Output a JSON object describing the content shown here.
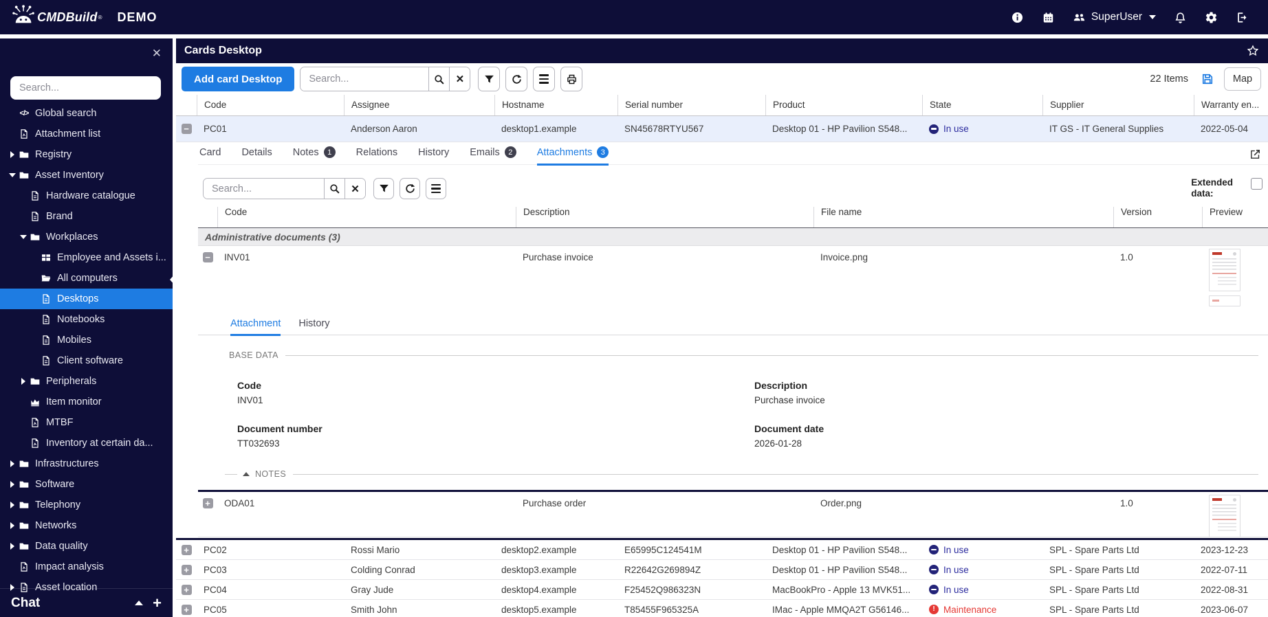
{
  "colors": {
    "navy": "#0e0e38",
    "blue": "#1e7ce2",
    "selected_row": "#e9effc",
    "inuse_text": "#2b2b9e",
    "maintenance_text": "#e53935",
    "group_bg": "#ececee"
  },
  "topbar": {
    "brand": "CMDBuild",
    "registered_mark": "®",
    "environment": "DEMO",
    "user": "SuperUser",
    "icons": [
      "info-icon",
      "calendar-icon",
      "users-icon",
      "bell-icon",
      "gear-icon",
      "logout-icon"
    ]
  },
  "sidebar": {
    "close_icon": "✕",
    "search_placeholder": "Search...",
    "items": [
      {
        "label": "Global search",
        "icon": "code",
        "level": 0,
        "arrow": "none"
      },
      {
        "label": "Attachment list",
        "icon": "file-pdf",
        "level": 0,
        "arrow": "none"
      },
      {
        "label": "Registry",
        "icon": "folder",
        "level": 0,
        "arrow": "right"
      },
      {
        "label": "Asset Inventory",
        "icon": "folder",
        "level": 0,
        "arrow": "down"
      },
      {
        "label": "Hardware catalogue",
        "icon": "file",
        "level": 1,
        "arrow": "none"
      },
      {
        "label": "Brand",
        "icon": "file",
        "level": 1,
        "arrow": "none"
      },
      {
        "label": "Workplaces",
        "icon": "folder",
        "level": 1,
        "arrow": "down"
      },
      {
        "label": "Employee and Assets i...",
        "icon": "table",
        "level": 2,
        "arrow": "none"
      },
      {
        "label": "All computers",
        "icon": "folder-open",
        "level": 2,
        "arrow": "none"
      },
      {
        "label": "Desktops",
        "icon": "file",
        "level": 2,
        "arrow": "none",
        "selected": true
      },
      {
        "label": "Notebooks",
        "icon": "file",
        "level": 2,
        "arrow": "none"
      },
      {
        "label": "Mobiles",
        "icon": "file",
        "level": 2,
        "arrow": "none"
      },
      {
        "label": "Client software",
        "icon": "file",
        "level": 2,
        "arrow": "none"
      },
      {
        "label": "Peripherals",
        "icon": "folder",
        "level": 1,
        "arrow": "right"
      },
      {
        "label": "Item monitor",
        "icon": "chart",
        "level": 1,
        "arrow": "none"
      },
      {
        "label": "MTBF",
        "icon": "file-pdf",
        "level": 1,
        "arrow": "none"
      },
      {
        "label": "Inventory at certain da...",
        "icon": "file-pdf",
        "level": 1,
        "arrow": "none"
      },
      {
        "label": "Infrastructures",
        "icon": "folder",
        "level": 0,
        "arrow": "right"
      },
      {
        "label": "Software",
        "icon": "folder",
        "level": 0,
        "arrow": "right"
      },
      {
        "label": "Telephony",
        "icon": "folder",
        "level": 0,
        "arrow": "right"
      },
      {
        "label": "Networks",
        "icon": "folder",
        "level": 0,
        "arrow": "right"
      },
      {
        "label": "Data quality",
        "icon": "folder",
        "level": 0,
        "arrow": "right"
      },
      {
        "label": "Impact analysis",
        "icon": "file-pdf",
        "level": 0,
        "arrow": "none"
      },
      {
        "label": "Asset location",
        "icon": "file",
        "level": 0,
        "arrow": "right"
      }
    ],
    "chat_label": "Chat"
  },
  "main": {
    "title": "Cards Desktop",
    "toolbar": {
      "add_label": "Add card Desktop",
      "search_placeholder": "Search...",
      "items_count": "22 Items",
      "map_label": "Map"
    },
    "grid": {
      "columns": [
        "Code",
        "Assignee",
        "Hostname",
        "Serial number",
        "Product",
        "State",
        "Supplier",
        "Warranty en..."
      ],
      "selected_row": {
        "code": "PC01",
        "assignee": "Anderson Aaron",
        "hostname": "desktop1.example",
        "serial": "SN45678RTYU567",
        "product": "Desktop 01 - HP Pavilion S548...",
        "state": "In use",
        "state_type": "inuse",
        "supplier": "IT GS - IT General Supplies",
        "warranty": "2022-05-04"
      },
      "rows": [
        {
          "code": "PC02",
          "assignee": "Rossi Mario",
          "hostname": "desktop2.example",
          "serial": "E65995C124541M",
          "product": "Desktop 01 - HP Pavilion S548...",
          "state": "In use",
          "state_type": "inuse",
          "supplier": "SPL - Spare Parts Ltd",
          "warranty": "2023-12-23"
        },
        {
          "code": "PC03",
          "assignee": "Colding Conrad",
          "hostname": "desktop3.example",
          "serial": "R22642G269894Z",
          "product": "Desktop 01 - HP Pavilion S548...",
          "state": "In use",
          "state_type": "inuse",
          "supplier": "SPL - Spare Parts Ltd",
          "warranty": "2022-07-11"
        },
        {
          "code": "PC04",
          "assignee": "Gray Jude",
          "hostname": "desktop4.example",
          "serial": "F25452Q986323N",
          "product": "MacBookPro - Apple 13 MVK51...",
          "state": "In use",
          "state_type": "inuse",
          "supplier": "SPL - Spare Parts Ltd",
          "warranty": "2022-08-31"
        },
        {
          "code": "PC05",
          "assignee": "Smith John",
          "hostname": "desktop5.example",
          "serial": "T85455F965325A",
          "product": "IMac - Apple MMQA2T G56146...",
          "state": "Maintenance",
          "state_type": "maint",
          "supplier": "SPL - Spare Parts Ltd",
          "warranty": "2023-06-07"
        }
      ]
    },
    "card_tabs": [
      {
        "label": "Card"
      },
      {
        "label": "Details"
      },
      {
        "label": "Notes",
        "badge": "1",
        "badge_style": "dark"
      },
      {
        "label": "Relations"
      },
      {
        "label": "History"
      },
      {
        "label": "Emails",
        "badge": "2",
        "badge_style": "dark"
      },
      {
        "label": "Attachments",
        "badge": "3",
        "badge_style": "blue",
        "active": true
      }
    ],
    "attachments": {
      "search_placeholder": "Search...",
      "extended_label_line1": "Extended",
      "extended_label_line2": "data:",
      "columns": [
        "Code",
        "Description",
        "File name",
        "Version",
        "Preview"
      ],
      "group_label": "Administrative documents (3)",
      "rows": [
        {
          "code": "INV01",
          "description": "Purchase invoice",
          "file_name": "Invoice.png",
          "version": "1.0",
          "expander": "minus",
          "expanded": true
        },
        {
          "code": "ODA01",
          "description": "Purchase order",
          "file_name": "Order.png",
          "version": "1.0",
          "expander": "plus",
          "expanded": false
        }
      ],
      "detail": {
        "tabs": [
          {
            "label": "Attachment",
            "active": true
          },
          {
            "label": "History",
            "active": false
          }
        ],
        "base_section_label": "BASE DATA",
        "notes_section_label": "NOTES",
        "fields": [
          {
            "label": "Code",
            "value": "INV01"
          },
          {
            "label": "Description",
            "value": "Purchase invoice"
          },
          {
            "label": "Document number",
            "value": "TT032693"
          },
          {
            "label": "Document date",
            "value": "2026-01-28"
          }
        ]
      }
    }
  }
}
